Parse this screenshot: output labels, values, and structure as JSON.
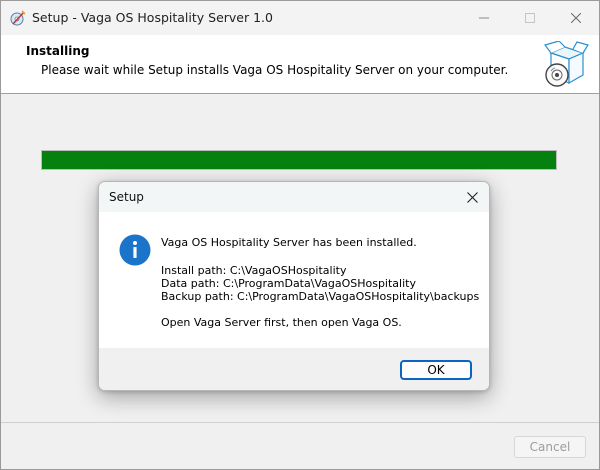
{
  "window": {
    "title": "Setup - Vaga OS Hospitality Server 1.0",
    "icon": "setup-wizard-icon"
  },
  "header": {
    "title": "Installing",
    "subtitle": "Please wait while Setup installs Vaga OS Hospitality Server on your computer.",
    "icon": "software-box-cd-icon"
  },
  "progress": {
    "fraction": 1.0,
    "color": "#06800f"
  },
  "footer": {
    "cancel_label": "Cancel"
  },
  "dialog": {
    "title": "Setup",
    "icon": "info-icon",
    "message": "Vaga OS Hospitality Server has been installed.",
    "install_path": "Install path: C:\\VagaOSHospitality",
    "data_path": "Data path: C:\\ProgramData\\VagaOSHospitality",
    "backup_path": "Backup path: C:\\ProgramData\\VagaOSHospitality\\backups",
    "note": "Open Vaga Server first, then open Vaga OS.",
    "ok_label": "OK",
    "accent": "#0b64c0"
  }
}
